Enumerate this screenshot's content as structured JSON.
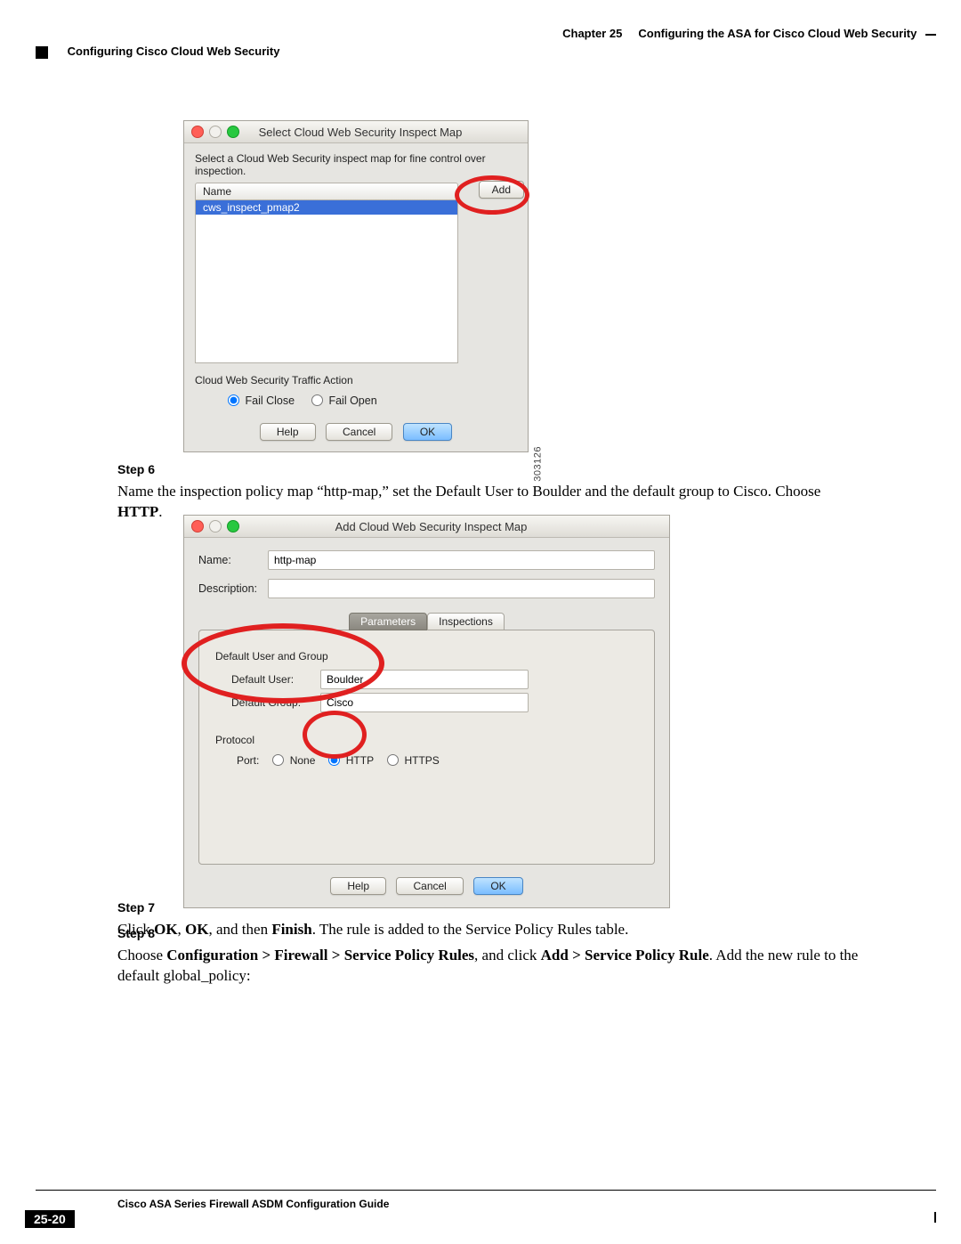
{
  "header": {
    "chapter_label": "Chapter 25",
    "chapter_title": "Configuring the ASA for Cisco Cloud Web Security",
    "section": "Configuring Cisco Cloud Web Security"
  },
  "win1": {
    "title": "Select Cloud Web Security Inspect Map",
    "instruction": "Select a Cloud Web Security inspect map for fine control over inspection.",
    "col_name": "Name",
    "add_btn": "Add",
    "selected": "cws_inspect_pmap2",
    "traffic_action_label": "Cloud Web Security Traffic Action",
    "fail_close": "Fail Close",
    "fail_open": "Fail Open",
    "help_btn": "Help",
    "cancel_btn": "Cancel",
    "ok_btn": "OK",
    "sidecode": "303126"
  },
  "step6": {
    "label": "Step 6",
    "text_a": "Name the inspection policy map “http-map,” set the Default User to Boulder and the default group to Cisco. Choose ",
    "bold": "HTTP",
    "text_b": "."
  },
  "win2": {
    "title": "Add Cloud Web Security Inspect Map",
    "name_label": "Name:",
    "name_value": "http-map",
    "desc_label": "Description:",
    "desc_value": "",
    "tab_params": "Parameters",
    "tab_insp": "Inspections",
    "grp_title": "Default User and Group",
    "def_user_label": "Default User:",
    "def_user_value": "Boulder",
    "def_group_label": "Default Group:",
    "def_group_value": "Cisco",
    "protocol_label": "Protocol",
    "port_label": "Port:",
    "opt_none": "None",
    "opt_http": "HTTP",
    "opt_https": "HTTPS",
    "help_btn": "Help",
    "cancel_btn": "Cancel",
    "ok_btn": "OK"
  },
  "step7": {
    "label": "Step 7",
    "a": "Click ",
    "b1": "OK",
    "c": ", ",
    "b2": "OK",
    "d": ", and then ",
    "b3": "Finish",
    "e": ". The rule is added to the Service Policy Rules table."
  },
  "step8": {
    "label": "Step 8",
    "a": "Choose ",
    "b1": "Configuration > Firewall > Service Policy Rules",
    "c": ", and click ",
    "b2": "Add > Service Policy Rule",
    "d": ". Add the new rule to the default global_policy:"
  },
  "footer": {
    "guide": "Cisco ASA Series Firewall ASDM Configuration Guide",
    "page": "25-20"
  }
}
